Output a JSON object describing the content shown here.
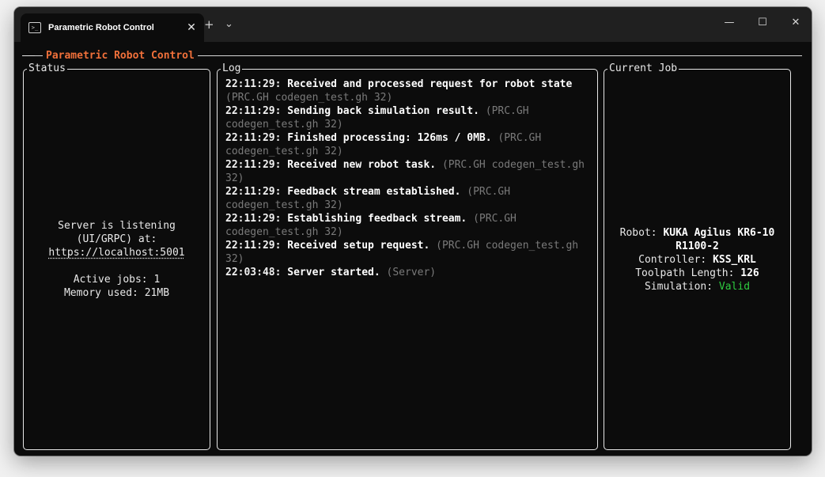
{
  "window": {
    "tab_title": "Parametric Robot Control",
    "tab_close": "✕",
    "new_tab": "+",
    "dropdown": "⌄",
    "minimize": "—",
    "maximize": "☐",
    "close": "✕"
  },
  "app": {
    "title": "Parametric Robot Control",
    "accent_color": "#f0703a"
  },
  "status": {
    "label": "Status",
    "line1": "Server is listening",
    "line2": "(UI/GRPC) at:",
    "url": "https://localhost:5001",
    "active_jobs": "Active jobs: 1",
    "memory": "Memory used: 21MB"
  },
  "log": {
    "label": "Log",
    "entries": [
      {
        "time": "22:11:29:",
        "message": "Received and processed request for robot state",
        "source": "(PRC.GH codegen_test.gh 32)"
      },
      {
        "time": "22:11:29:",
        "message": "Sending back simulation result.",
        "source": "(PRC.GH codegen_test.gh 32)"
      },
      {
        "time": "22:11:29:",
        "message": "Finished processing: 126ms / 0MB.",
        "source": "(PRC.GH codegen_test.gh 32)"
      },
      {
        "time": "22:11:29:",
        "message": "Received new robot task.",
        "source": "(PRC.GH codegen_test.gh 32)"
      },
      {
        "time": "22:11:29:",
        "message": "Feedback stream established.",
        "source": "(PRC.GH codegen_test.gh 32)"
      },
      {
        "time": "22:11:29:",
        "message": "Establishing feedback stream.",
        "source": "(PRC.GH codegen_test.gh 32)"
      },
      {
        "time": "22:11:29:",
        "message": "Received setup request.",
        "source": "(PRC.GH codegen_test.gh 32)"
      },
      {
        "time": "22:03:48:",
        "message": "Server started.",
        "source": "(Server)"
      }
    ]
  },
  "job": {
    "label": "Current Job",
    "robot_label": "Robot:",
    "robot_value": "KUKA Agilus KR6-10 R1100-2",
    "controller_label": "Controller:",
    "controller_value": "KSS_KRL",
    "toolpath_label": "Toolpath Length:",
    "toolpath_value": "126",
    "simulation_label": "Simulation:",
    "simulation_value": "Valid",
    "valid_color": "#2ecc40"
  }
}
